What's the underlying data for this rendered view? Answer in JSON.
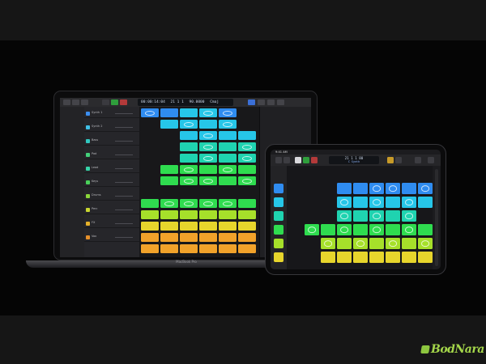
{
  "macbook": {
    "model_label": "MacBook Pro",
    "lcd_position": "00:00:14:04",
    "lcd_bars": "21  1  1",
    "lcd_tempo": "90.0000",
    "lcd_key": "Cmaj",
    "tracks": [
      {
        "name": "Synth 1",
        "color": "#3b8ef0"
      },
      {
        "name": "Synth 2",
        "color": "#3fc0e6"
      },
      {
        "name": "Bass",
        "color": "#31c8c0"
      },
      {
        "name": "Pad",
        "color": "#44d07a"
      },
      {
        "name": "Lead",
        "color": "#36d4a8"
      },
      {
        "name": "Keys",
        "color": "#4ad05a"
      },
      {
        "name": "Drums",
        "color": "#8bd63a"
      },
      {
        "name": "Perc",
        "color": "#c8d630"
      },
      {
        "name": "FX",
        "color": "#e6b12a"
      },
      {
        "name": "Vox",
        "color": "#e6902a"
      }
    ]
  },
  "ipad": {
    "status_time": "9:41 AM",
    "lcd_bars": "21  1  1  80",
    "lcd_track": "C  Synth"
  },
  "colors": {
    "blue": "#2f8cf0",
    "cyan": "#26c6e8",
    "teal": "#1fd3b0",
    "green": "#2fdc4f",
    "lime": "#a6e02a",
    "yellow": "#e7d52c",
    "orange": "#f1a22a"
  },
  "watermark": "BodNara"
}
